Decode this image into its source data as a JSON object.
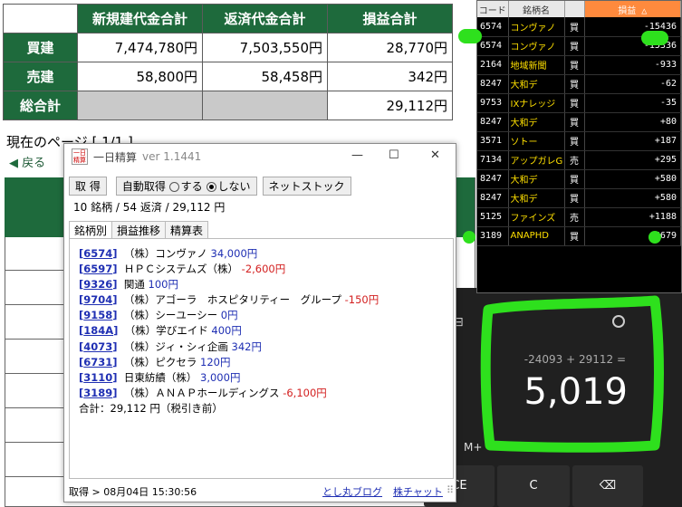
{
  "summary_table": {
    "headers": [
      "新規建代金合計",
      "返済代金合計",
      "損益合計"
    ],
    "rows": [
      {
        "label": "買建",
        "values": [
          "7,474,780円",
          "7,503,550円",
          "28,770円"
        ]
      },
      {
        "label": "売建",
        "values": [
          "58,800円",
          "58,458円",
          "342円"
        ]
      },
      {
        "label": "総合計",
        "values": [
          "",
          "",
          "29,112円"
        ]
      }
    ]
  },
  "page_indicator": "現在のページ [ 1/1 ]",
  "back_link": "戻る",
  "board": {
    "headers": [
      "コード",
      "銘柄名",
      "",
      "損益 △"
    ],
    "rows": [
      {
        "code": "6574",
        "name": "コンヴァノ",
        "side": "買",
        "pl": "-15436",
        "plcls": "neg"
      },
      {
        "code": "6574",
        "name": "コンヴァノ",
        "side": "買",
        "pl": "-15336",
        "plcls": "neg"
      },
      {
        "code": "2164",
        "name": "地域新聞",
        "side": "買",
        "pl": "-933",
        "plcls": "neg"
      },
      {
        "code": "8247",
        "name": "大和デ",
        "side": "買",
        "pl": "-62",
        "plcls": "neg"
      },
      {
        "code": "9753",
        "name": "IXナレッジ",
        "side": "買",
        "pl": "-35",
        "plcls": "neg"
      },
      {
        "code": "8247",
        "name": "大和デ",
        "side": "買",
        "pl": "+80",
        "plcls": "pos"
      },
      {
        "code": "3571",
        "name": "ソトー",
        "side": "買",
        "pl": "+187",
        "plcls": "pos"
      },
      {
        "code": "7134",
        "name": "アップガレG",
        "side": "売",
        "pl": "+295",
        "plcls": "pos"
      },
      {
        "code": "8247",
        "name": "大和デ",
        "side": "買",
        "pl": "+580",
        "plcls": "pos"
      },
      {
        "code": "8247",
        "name": "大和デ",
        "side": "買",
        "pl": "+580",
        "plcls": "pos"
      },
      {
        "code": "5125",
        "name": "ファインズ",
        "side": "売",
        "pl": "+1188",
        "plcls": "pos"
      },
      {
        "code": "3189",
        "name": "ANAPHD",
        "side": "買",
        "pl": "+6679",
        "plcls": "pos"
      }
    ]
  },
  "calculator": {
    "expression": "-24093 + 29112 =",
    "result": "5,019",
    "mem_label": "M+",
    "keys": [
      "CE",
      "C",
      "⌫"
    ]
  },
  "app": {
    "logo_top": "一日",
    "logo_bottom": "精算",
    "title": "一日精算",
    "version": "ver 1.1441",
    "buttons": {
      "fetch": "取 得",
      "auto_label": "自動取得",
      "opt_on": "する",
      "opt_off": "しない",
      "net": "ネットストック"
    },
    "summary": "10 銘柄 / 54 返済 / 29,112 円",
    "tabs": [
      "銘柄別",
      "損益推移",
      "精算表"
    ],
    "items": [
      {
        "code": "6574",
        "name": "（株）コンヴァノ",
        "pl": "34,000円",
        "dir": "up"
      },
      {
        "code": "6597",
        "name": "ＨＰＣシステムズ（株）",
        "pl": "-2,600円",
        "dir": "dn"
      },
      {
        "code": "9326",
        "name": "関通",
        "pl": "100円",
        "dir": "up"
      },
      {
        "code": "9704",
        "name": "（株）アゴーラ　ホスピタリティー　グループ",
        "pl": "-150円",
        "dir": "dn"
      },
      {
        "code": "9158",
        "name": "（株）シーユーシー",
        "pl": "0円",
        "dir": "up"
      },
      {
        "code": "184A",
        "name": "（株）学びエイド",
        "pl": "400円",
        "dir": "up"
      },
      {
        "code": "4073",
        "name": "（株）ジィ・シィ企画",
        "pl": "342円",
        "dir": "up"
      },
      {
        "code": "6731",
        "name": "（株）ピクセラ",
        "pl": "120円",
        "dir": "up"
      },
      {
        "code": "3110",
        "name": "日東紡績（株）",
        "pl": "3,000円",
        "dir": "up"
      },
      {
        "code": "3189",
        "name": "（株）ＡＮＡＰホールディングス",
        "pl": "-6,100円",
        "dir": "dn"
      }
    ],
    "total": "合計：29,112 円（税引き前）",
    "status": "取得 > 08月04日 15:30:56",
    "links": [
      "とし丸ブログ",
      "株チャット"
    ]
  },
  "annotation_color": "#2ee01d"
}
